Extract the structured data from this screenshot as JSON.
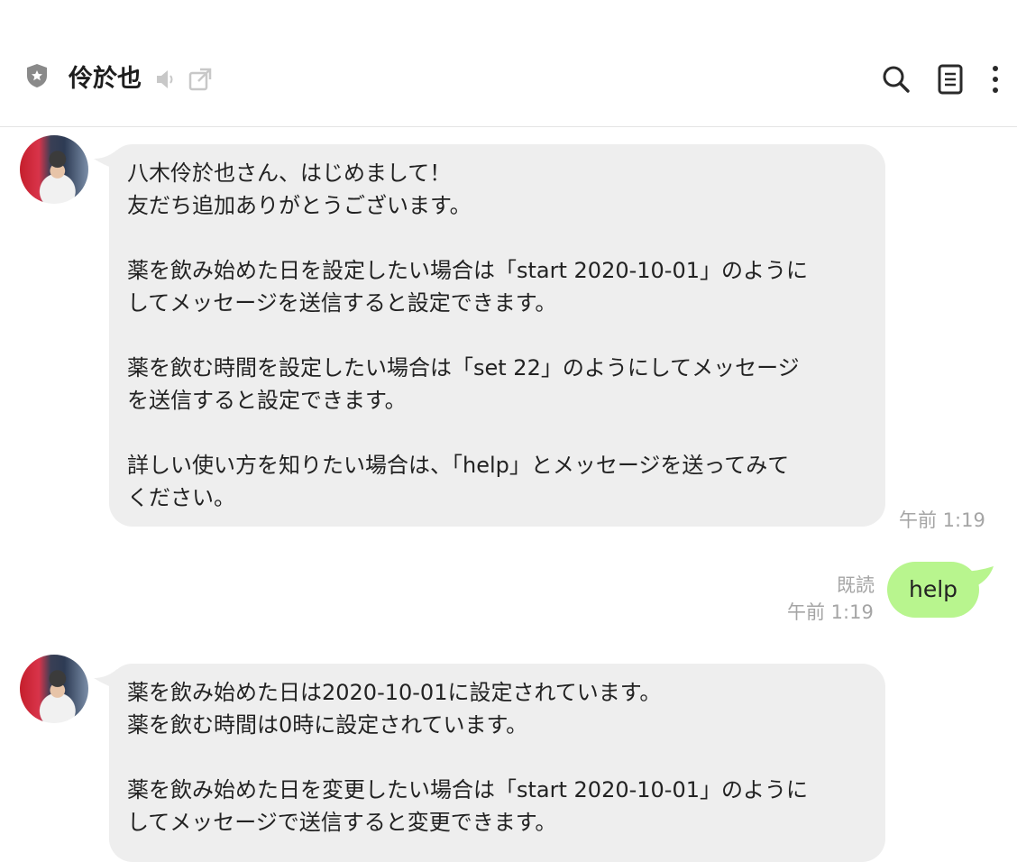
{
  "header": {
    "title": "伶於也",
    "icons": [
      "shield-icon",
      "mute-icon",
      "external-window-icon",
      "search-icon",
      "notes-icon",
      "more-icon"
    ]
  },
  "messages": [
    {
      "direction": "incoming",
      "text": "八木伶於也さん、はじめまして！\n友だち追加ありがとうございます。\n\n薬を飲み始めた日を設定したい場合は「start 2020-10-01」のように\nしてメッセージを送信すると設定できます。\n\n薬を飲む時間を設定したい場合は「set 22」のようにしてメッセージ\nを送信すると設定できます。\n\n詳しい使い方を知りたい場合は、「help」とメッセージを送ってみて\nください。",
      "time": "午前 1:19"
    },
    {
      "direction": "outgoing",
      "text": "help",
      "read_label": "既読",
      "time": "午前 1:19"
    },
    {
      "direction": "incoming",
      "text": "薬を飲み始めた日は2020-10-01に設定されています。\n薬を飲む時間は0時に設定されています。\n\n薬を飲み始めた日を変更したい場合は「start 2020-10-01」のように\nしてメッセージで送信すると変更できます。"
    }
  ],
  "colors": {
    "incoming_bubble": "#eeeeee",
    "outgoing_bubble": "#b8f58e",
    "meta_text": "#a5a5a5"
  }
}
